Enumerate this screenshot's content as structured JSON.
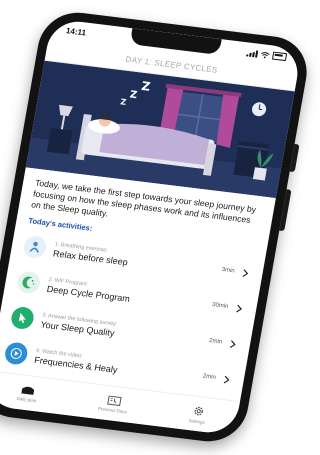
{
  "status_bar": {
    "time": "14:11"
  },
  "header": {
    "title": "DAY 1: SLEEP CYCLES"
  },
  "intro_text": "Today, we take the first step towards your sleep journey by focusing on how the sleep phases work and its influences on the Sleep quality.",
  "activities_title": "Today's activities:",
  "activities": [
    {
      "step": "1. Breathing exercise:",
      "title": "Relax before sleep",
      "duration": "3min",
      "color": "#3d86c9"
    },
    {
      "step": "2. IMF Program:",
      "title": "Deep Cycle Program",
      "duration": "30min",
      "color": "#2fa86a"
    },
    {
      "step": "3. Answer the following survey:",
      "title": "Your Sleep Quality",
      "duration": "2min",
      "color": "#1fae6d"
    },
    {
      "step": "4. Watch the video:",
      "title": "Frequencies & Healy",
      "duration": "2min",
      "color": "#2b8ed6"
    }
  ],
  "tab_bar": {
    "tabs": [
      {
        "label": "Daily plan",
        "icon": "daily-plan-icon"
      },
      {
        "label": "Previous Days",
        "icon": "previous-days-icon"
      },
      {
        "label": "Settings",
        "icon": "gear-icon"
      }
    ]
  },
  "colors": {
    "accent": "#1e4fa8",
    "hero_bg": "#1f2e57",
    "curtain": "#b04a9a",
    "blanket": "#c0b0d8"
  }
}
